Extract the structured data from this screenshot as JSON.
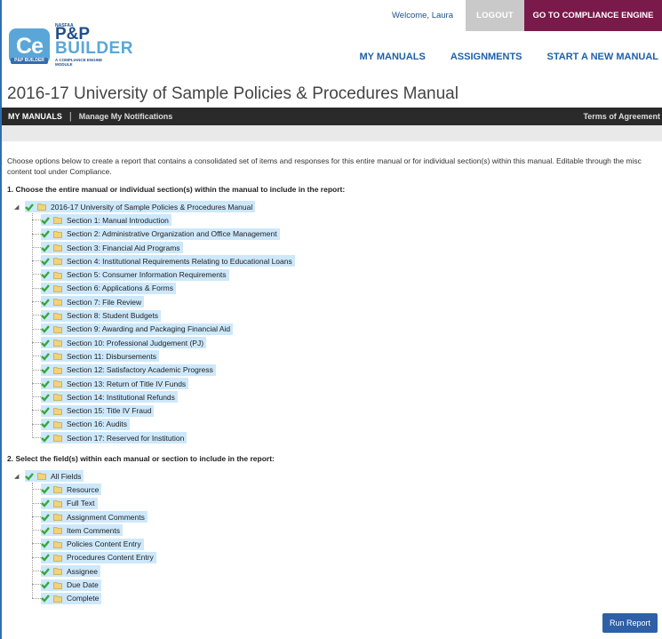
{
  "topbar": {
    "welcome": "Welcome, Laura",
    "logout": "LOGOUT",
    "compliance": "GO TO COMPLIANCE ENGINE"
  },
  "logo": {
    "ce": "Ce",
    "ce_sub": "P&P BUILDER",
    "top": "NASFAA",
    "pp": "P&P",
    "builder": "BUILDER",
    "module": "A COMPLIANCE ENGINE MODULE"
  },
  "nav": {
    "my_manuals": "MY MANUALS",
    "assignments": "ASSIGNMENTS",
    "start_new": "START A NEW MANUAL"
  },
  "page_title": "2016-17 University of Sample Policies & Procedures Manual",
  "subnav": {
    "my_manuals": "MY MANUALS",
    "notifications": "Manage My Notifications",
    "terms": "Terms of Agreement"
  },
  "intro": "Choose options below to create a report that contains a consolidated set of items and responses for this entire manual or for individual section(s) within this manual. Editable through the misc content tool under Compliance.",
  "section1": {
    "heading": "1. Choose the entire manual or individual section(s) within the manual to include in the report:",
    "root": "2016-17 University of Sample Policies & Procedures Manual",
    "items": [
      "Section 1: Manual Introduction",
      "Section 2: Administrative Organization and Office Management",
      "Section 3: Financial Aid Programs",
      "Section 4: Institutional Requirements Relating to Educational Loans",
      "Section 5: Consumer Information Requirements",
      "Section 6: Applications & Forms",
      "Section 7: File Review",
      "Section 8: Student Budgets",
      "Section 9: Awarding and Packaging Financial Aid",
      "Section 10: Professional Judgement (PJ)",
      "Section 11: Disbursements",
      "Section 12: Satisfactory Academic Progress",
      "Section 13: Return of Title IV Funds",
      "Section 14: Institutional Refunds",
      "Section 15: Title IV Fraud",
      "Section 16: Audits",
      "Section 17: Reserved for Institution"
    ]
  },
  "section2": {
    "heading": "2. Select the field(s) within each manual or section to include in the report:",
    "root": "All Fields",
    "items": [
      "Resource",
      "Full Text",
      "Assignment Comments",
      "Item Comments",
      "Policies Content Entry",
      "Procedures Content Entry",
      "Assignee",
      "Due Date",
      "Complete"
    ]
  },
  "run_report": "Run Report",
  "colors": {
    "accent": "#1f5fa8",
    "compliance": "#7a1a4a",
    "highlight": "#cde8fb",
    "check": "#3aa63a"
  }
}
